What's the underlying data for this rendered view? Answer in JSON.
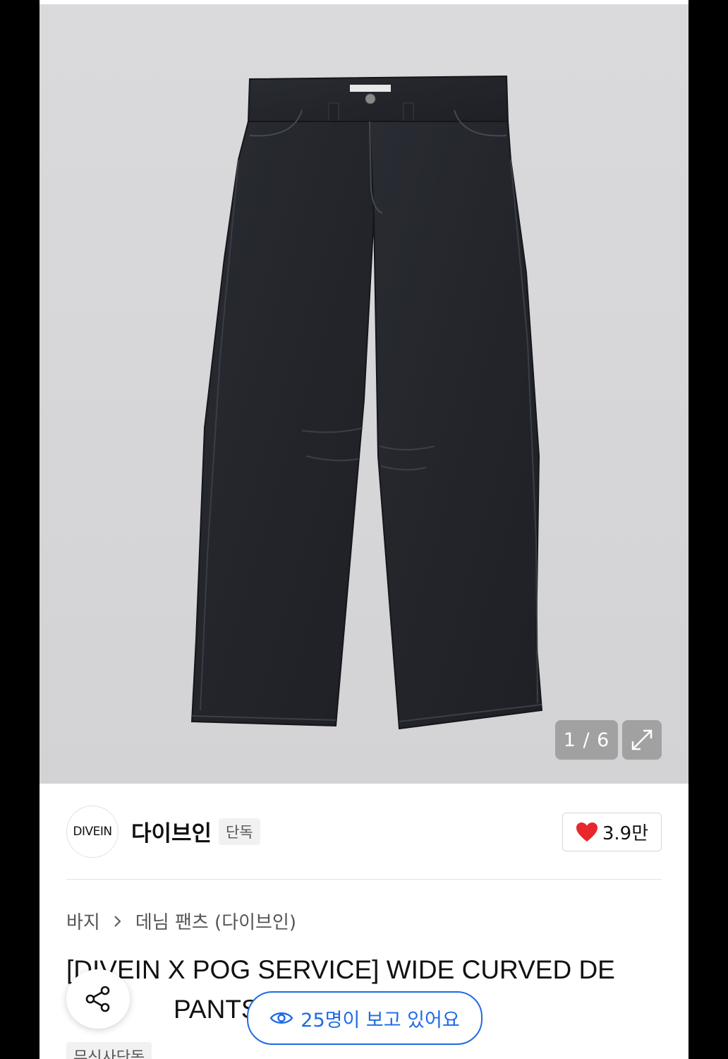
{
  "gallery": {
    "counter": "1 / 6",
    "expand_icon": "expand-arrows-icon",
    "image_alt": "wide curved denim pants"
  },
  "brand": {
    "logo_text": "DIVEIN",
    "name": "다이브인",
    "badge": "단독"
  },
  "like": {
    "icon": "heart-icon",
    "count": "3.9만",
    "color": "#e8262c"
  },
  "breadcrumb": {
    "items": [
      "바지",
      "데님 팬츠 (다이브인)"
    ]
  },
  "product": {
    "title_line1": "[DIVEIN X POG SERVICE] WIDE CURVED DE",
    "title_line2": "PANTS (I",
    "tag": "무신사단독"
  },
  "floating": {
    "share_icon": "share-icon",
    "viewers_icon": "eye-icon",
    "viewers_text": "25명이 보고 있어요",
    "accent": "#1e6be5"
  }
}
